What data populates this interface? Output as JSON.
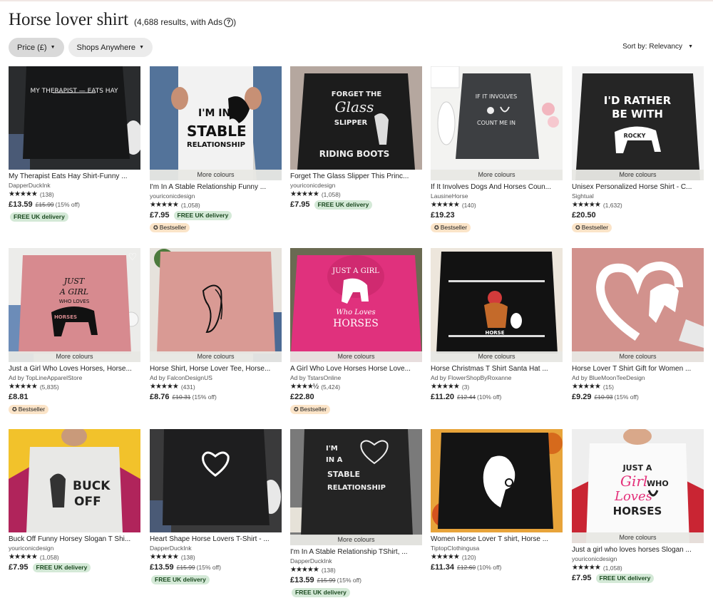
{
  "header": {
    "title": "Horse lover shirt",
    "results": "(4,688 results, with Ads",
    "results_close": ")",
    "help_icon": "?"
  },
  "filters": {
    "price": "Price (£)",
    "shops": "Shops Anywhere"
  },
  "sort": {
    "label": "Sort by: Relevancy"
  },
  "common": {
    "more_colours": "More colours",
    "free_delivery": "FREE UK delivery",
    "bestseller": "Bestseller",
    "stars": "★★★★★",
    "stars_half": "★★★★½"
  },
  "items": [
    {
      "name": "My Therapist Eats Hay Shirt-Funny ...",
      "shop": "DapperDuckInk",
      "reviews": "(138)",
      "price": "£13.59",
      "orig": "£15.99",
      "off": "(15% off)"
    },
    {
      "name": "I'm In A Stable Relationship Funny ...",
      "shop": "youriconicdesign",
      "reviews": "(1,058)",
      "price": "£7.95"
    },
    {
      "name": "Forget The Glass Slipper This Princ...",
      "shop": "youriconicdesign",
      "reviews": "(1,058)",
      "price": "£7.95"
    },
    {
      "name": "If It Involves Dogs And Horses Coun...",
      "shop": "LausineHorse",
      "reviews": "(140)",
      "price": "£19.23"
    },
    {
      "name": "Unisex Personalized Horse Shirt - C...",
      "shop": "Sightual",
      "reviews": "(1,632)",
      "price": "£20.50"
    },
    {
      "name": "Just a Girl Who Loves Horses, Horse...",
      "shop": "Ad by TopLineApparelStore",
      "reviews": "(5,835)",
      "price": "£8.81"
    },
    {
      "name": "Horse Shirt, Horse Lover Tee, Horse...",
      "shop": "Ad by FalconDesignUS",
      "reviews": "(431)",
      "price": "£8.76",
      "orig": "£10.31",
      "off": "(15% off)"
    },
    {
      "name": "A Girl Who Love Horses Horse Love...",
      "shop": "Ad by TstarsOnline",
      "reviews": "(5,424)",
      "price": "£22.80"
    },
    {
      "name": "Horse Christmas T Shirt Santa Hat ...",
      "shop": "Ad by FlowerShopByRoxanne",
      "reviews": "(3)",
      "price": "£11.20",
      "orig": "£12.44",
      "off": "(10% off)"
    },
    {
      "name": "Horse Lover T Shirt Gift for Women ...",
      "shop": "Ad by BlueMoonTeeDesign",
      "reviews": "(15)",
      "price": "£9.29",
      "orig": "£10.93",
      "off": "(15% off)"
    },
    {
      "name": "Buck Off Funny Horsey Slogan T Shi...",
      "shop": "youriconicdesign",
      "reviews": "(1,058)",
      "price": "£7.95"
    },
    {
      "name": "Heart Shape Horse Lovers T-Shirt - ...",
      "shop": "DapperDuckInk",
      "reviews": "(138)",
      "price": "£13.59",
      "orig": "£15.99",
      "off": "(15% off)"
    },
    {
      "name": "I'm In A Stable Relationship TShirt, ...",
      "shop": "DapperDuckInk",
      "reviews": "(138)",
      "price": "£13.59",
      "orig": "£15.99",
      "off": "(15% off)"
    },
    {
      "name": "Women Horse Lover T shirt, Horse ...",
      "shop": "TiptopClothingusa",
      "reviews": "(120)",
      "price": "£11.34",
      "orig": "£12.60",
      "off": "(10% off)"
    },
    {
      "name": "Just a girl who loves horses Slogan ...",
      "shop": "youriconicdesign",
      "reviews": "(1,058)",
      "price": "£7.95"
    }
  ],
  "artwork": {
    "t0": "MY THERAPIST — EATS HAY",
    "t1a": "I'M IN A",
    "t1b": "STABLE",
    "t1c": "RELATIONSHIP",
    "t2a": "FORGET THE",
    "t2b": "Glass",
    "t2c": "SLIPPER",
    "t2d": "RIDING BOOTS",
    "t3a": "IF IT INVOLVES",
    "t3b": "COUNT ME IN",
    "t4a": "I'D RATHER",
    "t4b": "BE WITH",
    "t4c": "ROCKY",
    "t5a": "JUST",
    "t5b": "A GIRL",
    "t5c": "WHO LOVES",
    "t5d": "HORSES",
    "t7a": "JUST A GIRL",
    "t7b": "Who Loves",
    "t7c": "HORSES",
    "t8": "HORSE",
    "t10a": "BUCK",
    "t10b": "OFF",
    "t12a": "I'M",
    "t12b": "IN A",
    "t12c": "STABLE",
    "t12d": "RELATIONSHIP",
    "t14a": "JUST A",
    "t14b": "Girl",
    "t14c": "WHO",
    "t14d": "Loves",
    "t14e": "HORSES"
  },
  "colors": {
    "accent": "#222222",
    "free_bg": "#d4e9d7",
    "best_bg": "#fbe4c8"
  }
}
